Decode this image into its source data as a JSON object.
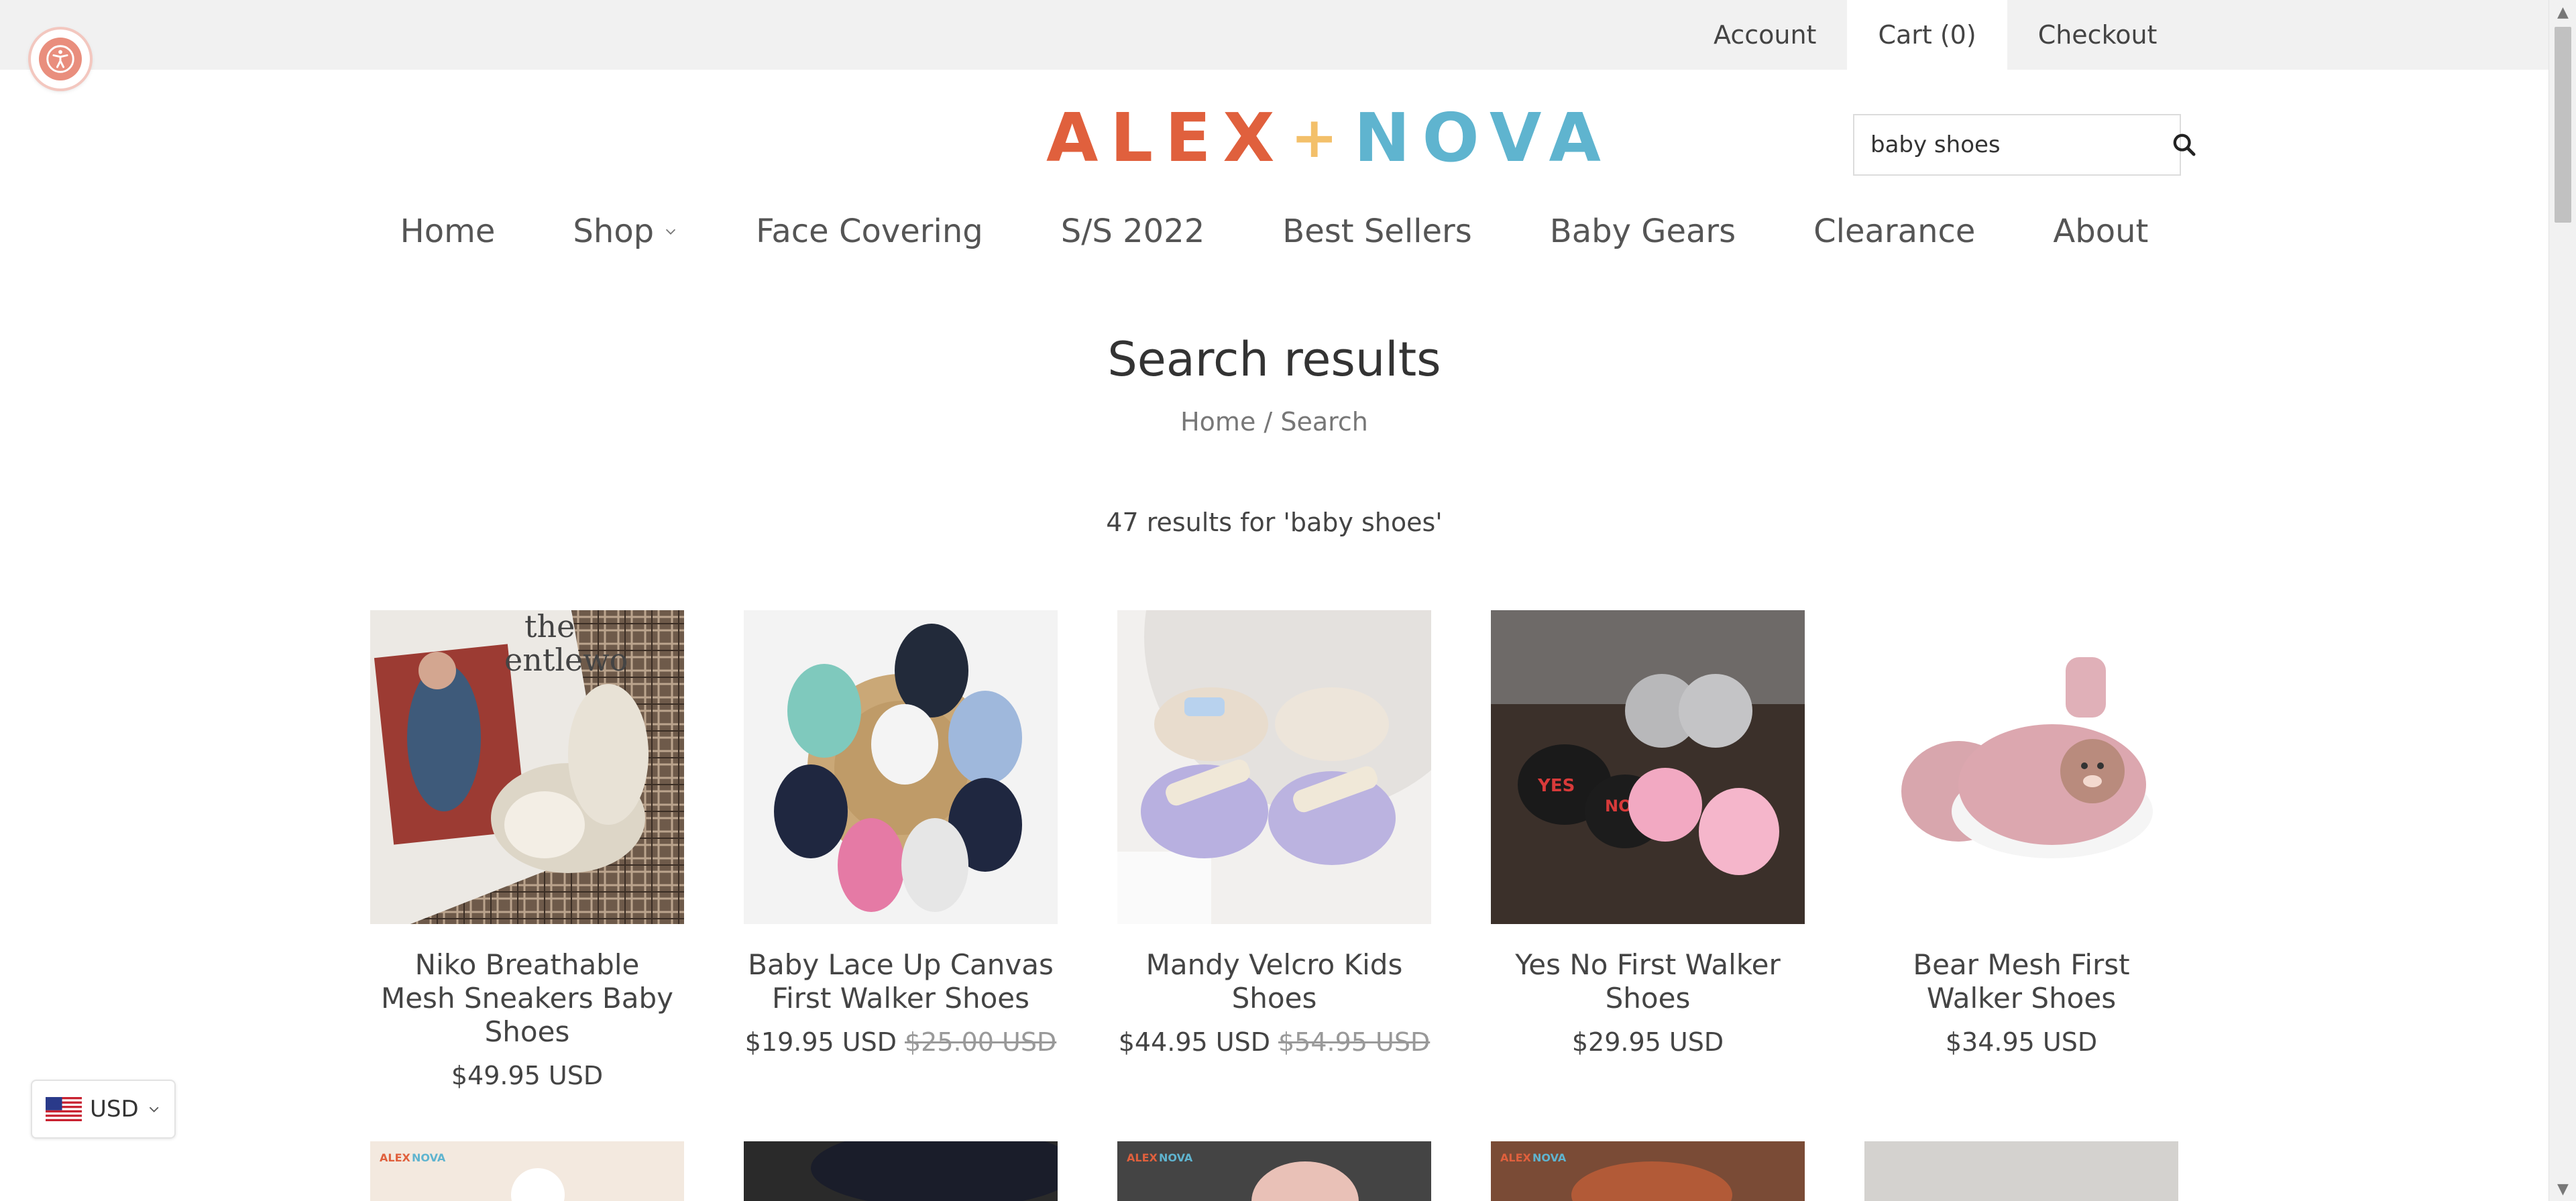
{
  "topbar": {
    "account": "Account",
    "cart": "Cart (0)",
    "checkout": "Checkout"
  },
  "logo": {
    "left": "ALEX",
    "plus": "+",
    "right": "NOVA"
  },
  "search": {
    "value": "baby shoes",
    "icon": "search-icon"
  },
  "nav": [
    {
      "label": "Home"
    },
    {
      "label": "Shop"
    },
    {
      "label": "Face Covering"
    },
    {
      "label": "S/S 2022"
    },
    {
      "label": "Best Sellers"
    },
    {
      "label": "Baby Gears"
    },
    {
      "label": "Clearance"
    },
    {
      "label": "About"
    }
  ],
  "page": {
    "title": "Search results",
    "breadcrumb_home": "Home",
    "breadcrumb_sep": "/",
    "breadcrumb_current": "Search",
    "results_text": "47 results for 'baby shoes'"
  },
  "products": [
    {
      "name": "Niko Breathable Mesh Sneakers Baby Shoes",
      "price": "$49.95 USD",
      "old_price": ""
    },
    {
      "name": "Baby Lace Up Canvas First Walker Shoes",
      "price": "$19.95 USD",
      "old_price": "$25.00 USD"
    },
    {
      "name": "Mandy Velcro Kids Shoes",
      "price": "$44.95 USD",
      "old_price": "$54.95 USD"
    },
    {
      "name": "Yes No First Walker Shoes",
      "price": "$29.95 USD",
      "old_price": ""
    },
    {
      "name": "Bear Mesh First Walker Shoes",
      "price": "$34.95 USD",
      "old_price": ""
    }
  ],
  "currency": {
    "code": "USD"
  },
  "colors": {
    "brand_orange": "#e0603d",
    "brand_blue": "#5fb4cf",
    "brand_yellow": "#f3c06a",
    "a11y": "#e98e7d"
  }
}
